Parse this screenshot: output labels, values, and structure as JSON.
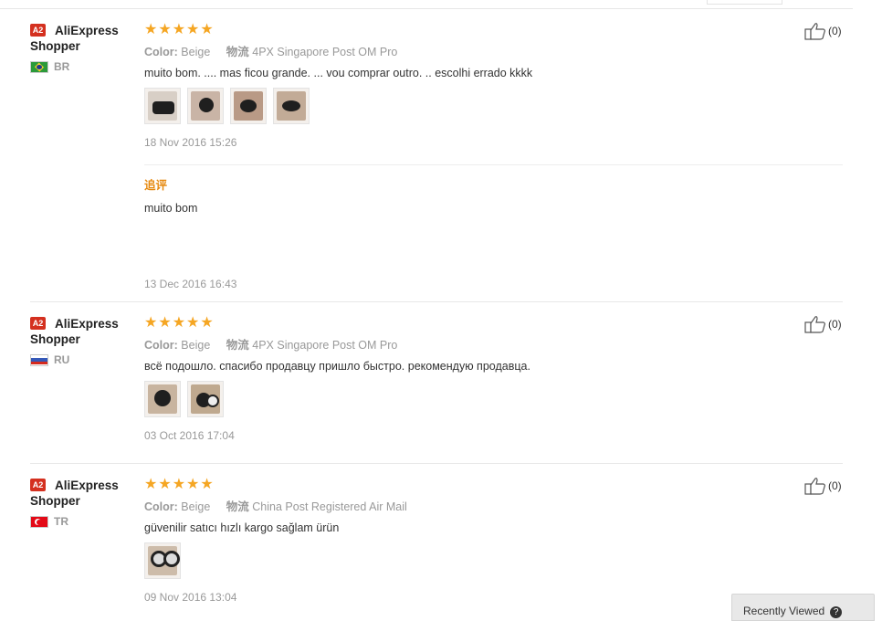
{
  "reviews": [
    {
      "badge": "A2",
      "user_line1": "AliExpress",
      "user_line2": "Shopper",
      "country": "BR",
      "stars": 5,
      "color_label": "Color:",
      "color_value": "Beige",
      "shipping_label": "物流",
      "shipping_value": "4PX Singapore Post OM Pro",
      "text": "muito bom. .... mas ficou grande. ... vou comprar outro. .. escolhi errado kkkk",
      "date": "18 Nov 2016 15:26",
      "likes": "(0)",
      "followup": {
        "label": "追评",
        "text": "muito bom",
        "date": "13 Dec 2016 16:43"
      }
    },
    {
      "badge": "A2",
      "user_line1": "AliExpress",
      "user_line2": "Shopper",
      "country": "RU",
      "stars": 5,
      "color_label": "Color:",
      "color_value": "Beige",
      "shipping_label": "物流",
      "shipping_value": "4PX Singapore Post OM Pro",
      "text": "всё подошло. спасибо продавцу пришло быстро. рекомендую продавца.",
      "date": "03 Oct 2016 17:04",
      "likes": "(0)"
    },
    {
      "badge": "A2",
      "user_line1": "AliExpress",
      "user_line2": "Shopper",
      "country": "TR",
      "stars": 5,
      "color_label": "Color:",
      "color_value": "Beige",
      "shipping_label": "物流",
      "shipping_value": "China Post Registered Air Mail",
      "text": "güvenilir satıcı hızlı kargo sağlam ürün",
      "date": "09 Nov 2016 13:04",
      "likes": "(0)"
    }
  ],
  "help_tab": {
    "label": "Recently Viewed"
  },
  "icons": {
    "star": "star-icon",
    "like": "thumbs-up-icon",
    "help": "question-icon"
  },
  "colors": {
    "star": "#f5a623",
    "badge": "#d4301f",
    "followup": "#e6890f"
  }
}
